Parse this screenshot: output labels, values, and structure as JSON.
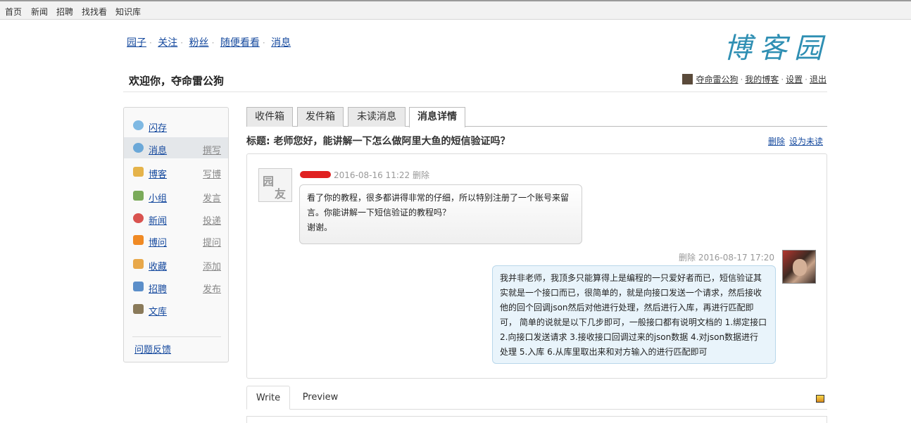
{
  "topbar": {
    "links": [
      "首页",
      "新闻",
      "招聘",
      "找找看",
      "知识库"
    ]
  },
  "nav": {
    "links": [
      "园子",
      "关注",
      "粉丝",
      "随便看看",
      "消息"
    ]
  },
  "logo": "博客园",
  "welcome": "欢迎你，夺命雷公狗",
  "usermenu": {
    "username": "夺命雷公狗",
    "my_blog": "我的博客",
    "settings": "设置",
    "logout": "退出"
  },
  "sidebar": {
    "items": [
      {
        "label": "闪存",
        "action": "",
        "icon": "flash-icon",
        "color": "#7fb9e3"
      },
      {
        "label": "消息",
        "action": "撰写",
        "icon": "message-icon",
        "color": "#6ba8d8"
      },
      {
        "label": "博客",
        "action": "写博",
        "icon": "pencil-icon",
        "color": "#e5b34a"
      },
      {
        "label": "小组",
        "action": "发言",
        "icon": "group-icon",
        "color": "#7aaa5a"
      },
      {
        "label": "新闻",
        "action": "投递",
        "icon": "news-icon",
        "color": "#d9534f"
      },
      {
        "label": "博问",
        "action": "提问",
        "icon": "question-icon",
        "color": "#f08a24"
      },
      {
        "label": "收藏",
        "action": "添加",
        "icon": "folder-icon",
        "color": "#e8a84a"
      },
      {
        "label": "招聘",
        "action": "发布",
        "icon": "person-icon",
        "color": "#5b8ec9"
      },
      {
        "label": "文库",
        "action": "",
        "icon": "book-icon",
        "color": "#8a7a5a"
      }
    ],
    "feedback": "问题反馈"
  },
  "tabs": [
    "收件箱",
    "发件箱",
    "未读消息",
    "消息详情"
  ],
  "subject": "标题: 老师您好，能讲解一下怎么做阿里大鱼的短信验证吗？",
  "subject_actions": {
    "delete": "删除",
    "mark_unread": "设为未读"
  },
  "messages": {
    "left": {
      "avatar_text_1": "园",
      "avatar_text_2": "友",
      "time": "2016-08-16 11:22",
      "delete": "删除",
      "line1": "看了你的教程，很多都讲得非常的仔细，所以特别注册了一个账号来留",
      "line2": "言。你能讲解一下短信验证的教程吗？",
      "line3": "谢谢。"
    },
    "right": {
      "delete": "删除",
      "time": "2016-08-17 17:20",
      "line1": "我并非老师，我顶多只能算得上是编程的一只爱好者而已，短信验证其",
      "line2": "实就是一个接口而已，很简单的，就是向接口发送一个请求，然后接收",
      "line3": "他的回个回调json然后对他进行处理，然后进行入库，再进行匹配即",
      "line4": "可，  简单的说就是以下几步即可，一般接口都有说明文档的 1.绑定接口",
      "line5": "2.向接口发送请求 3.接收接口回调过来的json数据 4.对json数据进行",
      "line6": "处理 5.入库 6.从库里取出来和对方输入的进行匹配即可"
    }
  },
  "editor": {
    "write": "Write",
    "preview": "Preview"
  }
}
